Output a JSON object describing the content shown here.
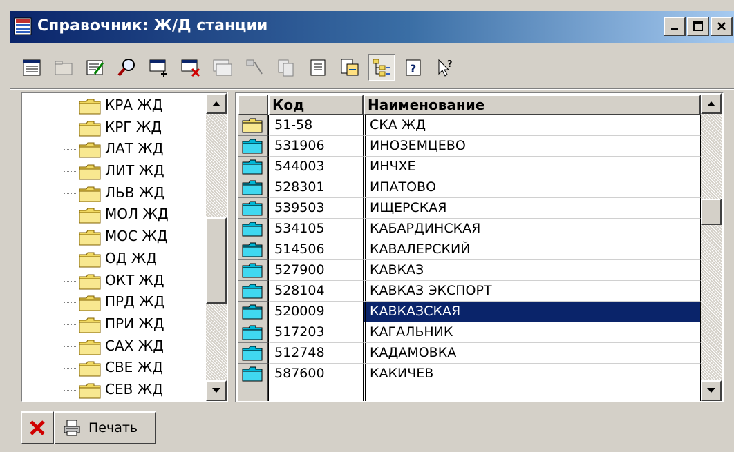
{
  "window": {
    "title": "Справочник: Ж/Д станции"
  },
  "toolbar": {
    "icons": [
      "list-view-icon",
      "folder-icon",
      "edit-record-icon",
      "search-icon",
      "add-record-icon",
      "delete-record-icon",
      "copy-record-icon",
      "move-record-icon",
      "copy-icon",
      "paste-icon",
      "export-icon",
      "tree-view-icon",
      "help-icon",
      "context-help-icon"
    ]
  },
  "tree": {
    "items": [
      "КРА ЖД",
      "КРГ ЖД",
      "ЛАТ ЖД",
      "ЛИТ ЖД",
      "ЛЬВ ЖД",
      "МОЛ ЖД",
      "МОС ЖД",
      "ОД ЖД",
      "ОКТ ЖД",
      "ПРД ЖД",
      "ПРИ ЖД",
      "САХ ЖД",
      "СВЕ ЖД",
      "СЕВ ЖД"
    ]
  },
  "grid": {
    "columns": {
      "code": "Код",
      "name": "Наименование"
    },
    "rows": [
      {
        "code": "51-58",
        "name": "СКА ЖД",
        "icon": "open-folder-icon",
        "selected": false
      },
      {
        "code": "531906",
        "name": "ИНОЗЕМЦЕВО",
        "icon": "folder-icon",
        "selected": false
      },
      {
        "code": "544003",
        "name": "ИНЧХЕ",
        "icon": "folder-icon",
        "selected": false
      },
      {
        "code": "528301",
        "name": "ИПАТОВО",
        "icon": "folder-icon",
        "selected": false
      },
      {
        "code": "539503",
        "name": "ИЩЕРСКАЯ",
        "icon": "folder-icon",
        "selected": false
      },
      {
        "code": "534105",
        "name": "КАБАРДИНСКАЯ",
        "icon": "folder-icon",
        "selected": false
      },
      {
        "code": "514506",
        "name": "КАВАЛЕРСКИЙ",
        "icon": "folder-icon",
        "selected": false
      },
      {
        "code": "527900",
        "name": "КАВКАЗ",
        "icon": "folder-icon",
        "selected": false
      },
      {
        "code": "528104",
        "name": "КАВКАЗ ЭКСПОРТ",
        "icon": "folder-icon",
        "selected": false
      },
      {
        "code": "520009",
        "name": "КАВКАЗСКАЯ",
        "icon": "folder-icon",
        "selected": true
      },
      {
        "code": "517203",
        "name": "КАГАЛЬНИК",
        "icon": "folder-icon",
        "selected": false
      },
      {
        "code": "512748",
        "name": "КАДАМОВКА",
        "icon": "folder-icon",
        "selected": false
      },
      {
        "code": "587600",
        "name": "КАКИЧЕВ",
        "icon": "folder-icon",
        "selected": false
      }
    ]
  },
  "buttons": {
    "print_label": "Печать"
  },
  "colors": {
    "title_start": "#0a246a",
    "title_end": "#a6caf0",
    "selection": "#0a246a",
    "face": "#d4d0c8",
    "folder": "#f0d860"
  }
}
